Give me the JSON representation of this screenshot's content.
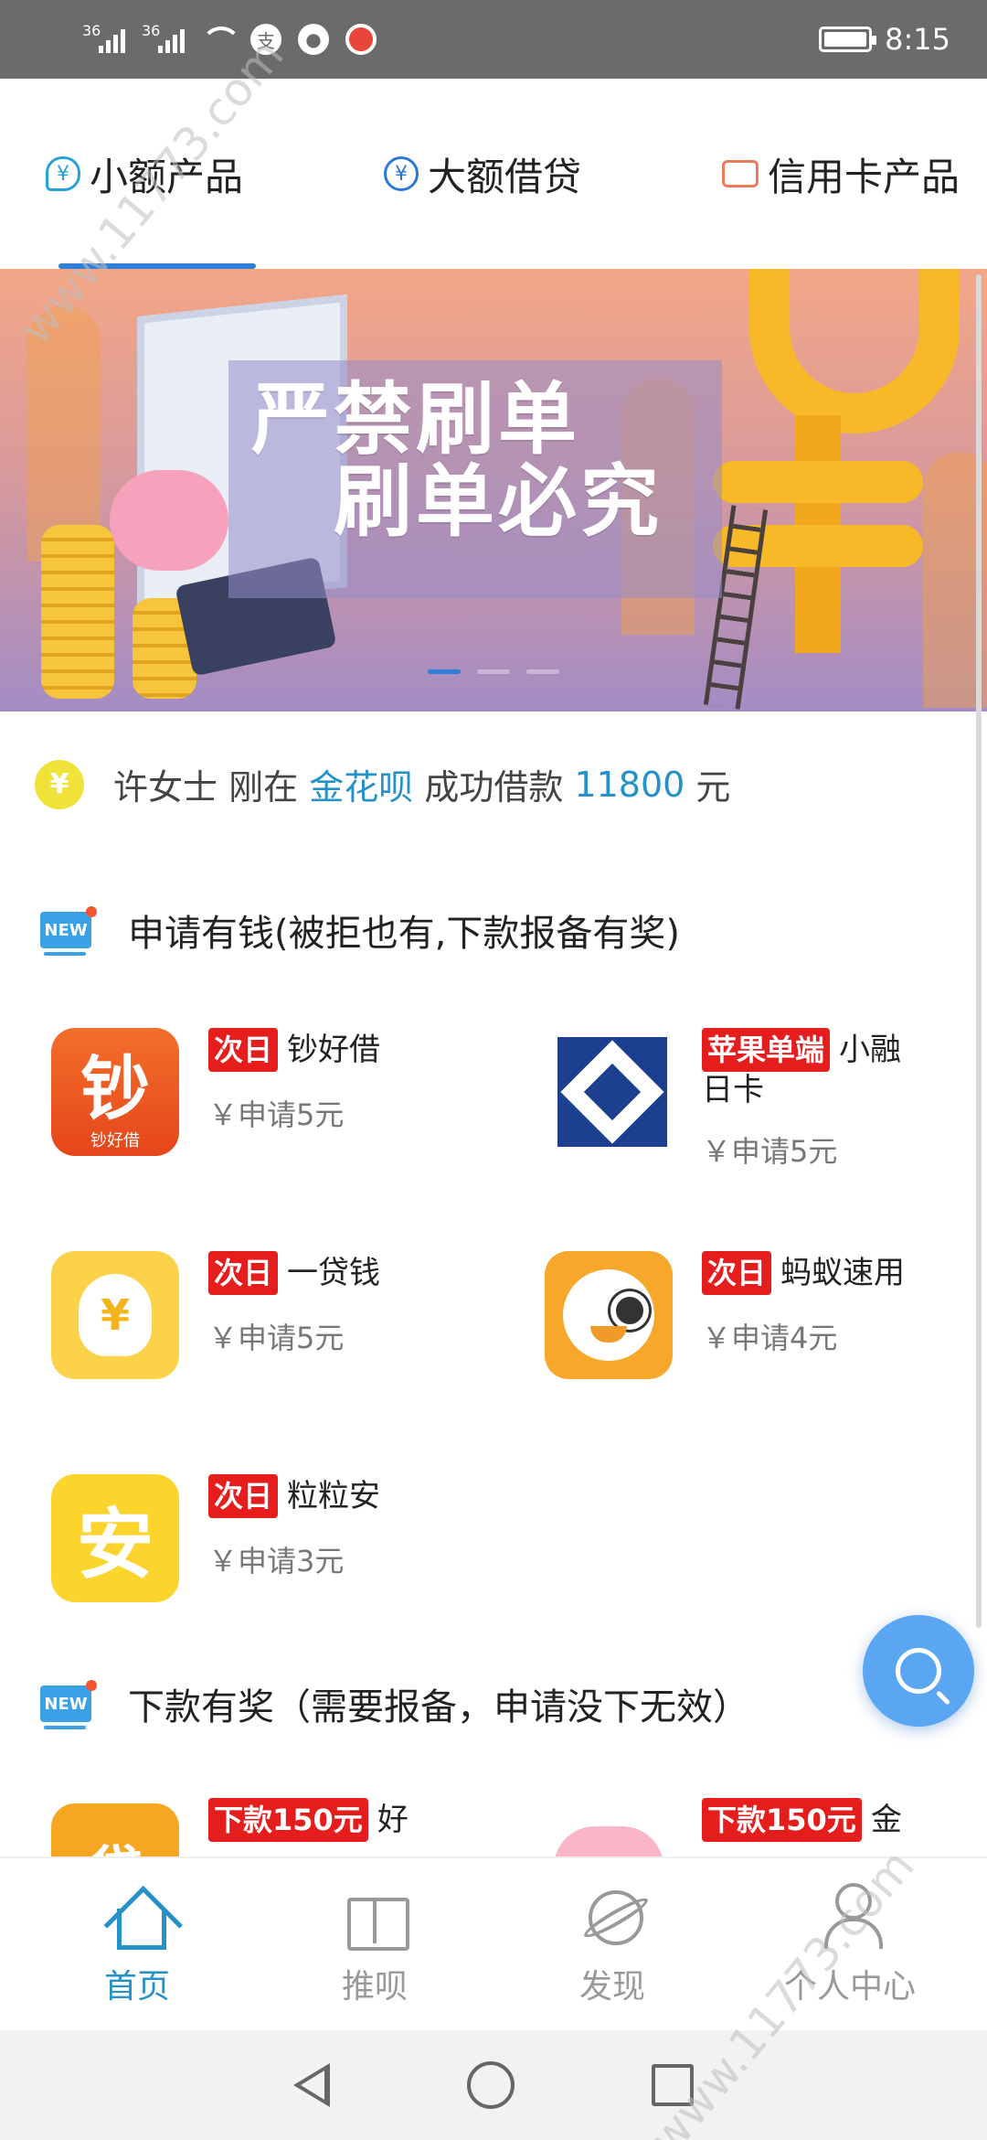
{
  "status_bar": {
    "signal1_label": "36",
    "signal2_label": "36",
    "pay_glyph": "支",
    "time": "8:15"
  },
  "tabs": [
    {
      "label": "小额产品",
      "icon": "cloud-yen-icon",
      "active": true
    },
    {
      "label": "大额借贷",
      "icon": "yen-circle-icon",
      "active": false
    },
    {
      "label": "信用卡产品",
      "icon": "credit-card-icon",
      "active": false
    }
  ],
  "banner": {
    "line1": "严禁刷单",
    "line2": "刷单必究",
    "dots": 3,
    "active_dot": 0
  },
  "notice": {
    "icon_glyph": "¥",
    "name": "许女士",
    "action": "刚在",
    "product": "金花呗",
    "result": "成功借款",
    "amount": "11800",
    "unit": "元"
  },
  "section1": {
    "badge": "NEW",
    "title": "申请有钱(被拒也有,下款报备有奖)"
  },
  "products": [
    {
      "tag": "次日",
      "name": "钞好借",
      "price": "￥申请5元",
      "logo_text": "钞",
      "logo_sub": "钞好借"
    },
    {
      "tag": "苹果单端",
      "name": "小融日卡",
      "price": "￥申请5元"
    },
    {
      "tag": "次日",
      "name": "一贷钱",
      "price": "￥申请5元",
      "logo_text": "¥"
    },
    {
      "tag": "次日",
      "name": "蚂蚁速用",
      "price": "￥申请4元"
    },
    {
      "tag": "次日",
      "name": "粒粒安",
      "price": "￥申请3元",
      "logo_text": "安"
    }
  ],
  "section2": {
    "badge": "NEW",
    "title": "下款有奖（需要报备，申请没下无效）"
  },
  "products2": [
    {
      "tag": "下款150元",
      "name": "好",
      "logo_text": "贷"
    },
    {
      "tag": "下款150元",
      "name": "金"
    }
  ],
  "bottom_nav": [
    {
      "label": "首页",
      "icon": "home-icon",
      "active": true
    },
    {
      "label": "推呗",
      "icon": "gift-icon",
      "active": false
    },
    {
      "label": "发现",
      "icon": "planet-icon",
      "active": false
    },
    {
      "label": "个人中心",
      "icon": "user-icon",
      "active": false
    }
  ],
  "watermark": "www.11773.com",
  "colors": {
    "accent": "#2591c8",
    "tab_indicator": "#2f7fd8",
    "tag_red": "#e51d1d",
    "status_bar": "#6b6b6b",
    "fab": "#5aa6f2"
  }
}
